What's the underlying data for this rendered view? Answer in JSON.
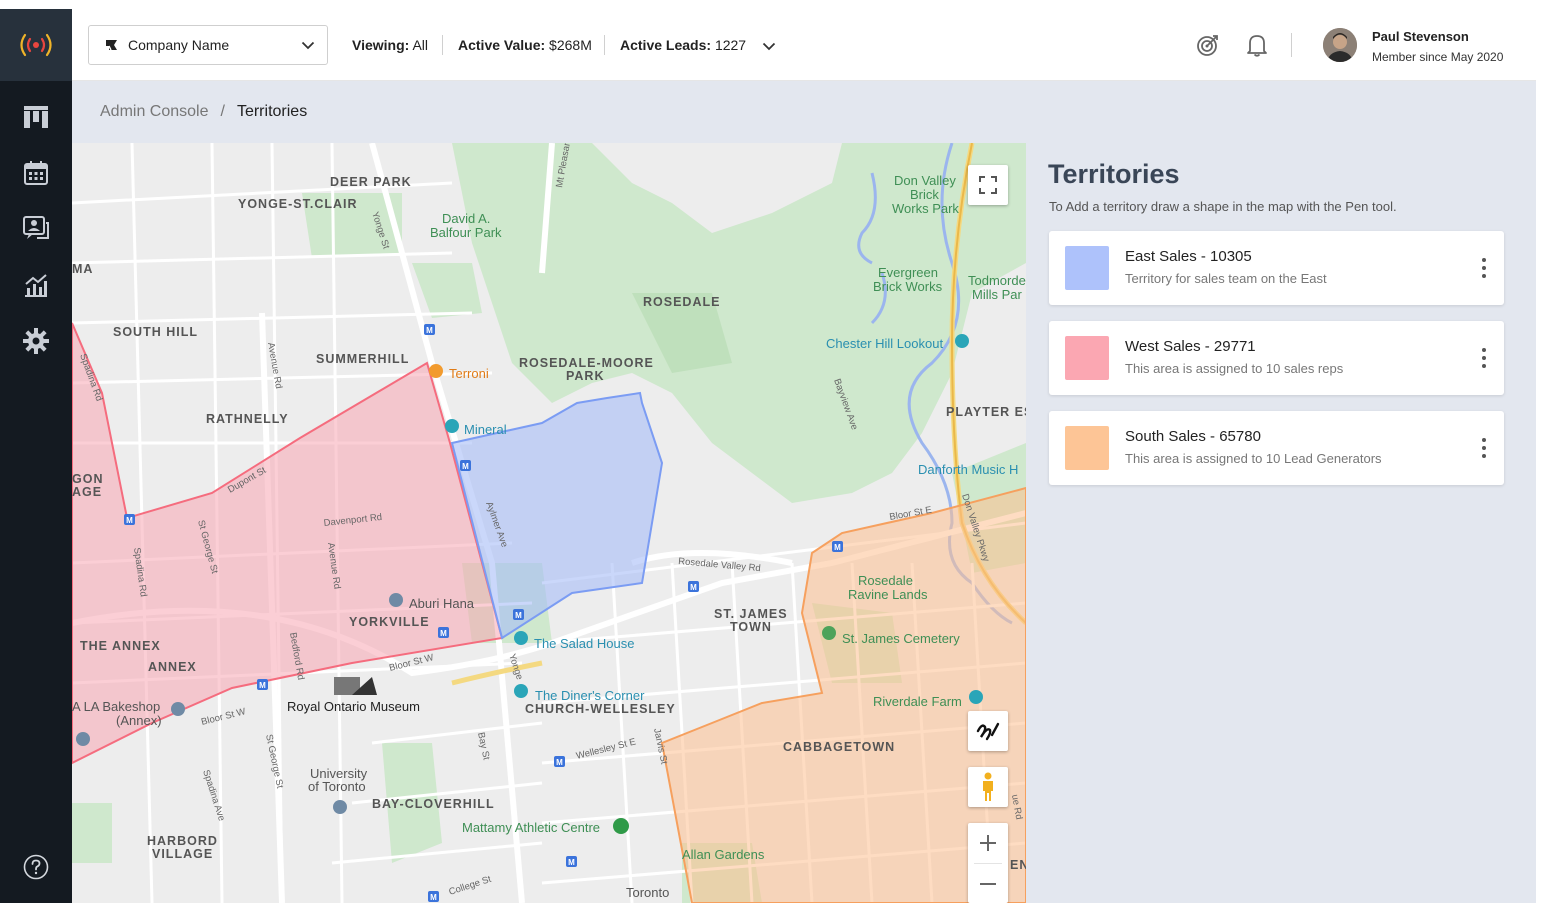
{
  "topbar": {
    "company_name": "Company Name",
    "viewing_label": "Viewing:",
    "viewing_value": "All",
    "active_value_label": "Active Value:",
    "active_value": "$268M",
    "active_leads_label": "Active Leads:",
    "active_leads": "1227"
  },
  "user": {
    "name": "Paul Stevenson",
    "since": "Member since May 2020"
  },
  "sidebar": {
    "items": [
      {
        "icon": "dashboard-icon"
      },
      {
        "icon": "calendar-icon"
      },
      {
        "icon": "contacts-icon"
      },
      {
        "icon": "analytics-icon"
      },
      {
        "icon": "settings-icon"
      }
    ],
    "help_icon": "help-icon"
  },
  "breadcrumb": {
    "root": "Admin Console",
    "separator": "/",
    "current": "Territories"
  },
  "panel": {
    "title": "Territories",
    "subtitle": "To Add a territory draw a shape in the map with the Pen tool."
  },
  "territories": [
    {
      "title": "East Sales - 10305",
      "desc": "Territory for sales team on the East",
      "color": "#aec2fb"
    },
    {
      "title": "West Sales - 29771",
      "desc": "This area is assigned to 10 sales reps",
      "color": "#fba7b2"
    },
    {
      "title": "South Sales - 65780",
      "desc": "This area is assigned to 10 Lead Generators",
      "color": "#fdc596"
    }
  ],
  "map": {
    "labels": {
      "deer_park": "DEER PARK",
      "yonge_st_clair": "YONGE-ST.CLAIR",
      "david_balfour_1": "David A.",
      "david_balfour_2": "Balfour Park",
      "don_valley_1": "Don Valley",
      "don_valley_2": "Brick",
      "don_valley_3": "Works Park",
      "evergreen_1": "Evergreen",
      "evergreen_2": "Brick Works",
      "todmorden_1": "Todmorde",
      "todmorden_2": "Mills Par",
      "rosedale": "ROSEDALE",
      "south_hill": "SOUTH HILL",
      "summerhill": "SUMMERHILL",
      "rosedale_moore_1": "ROSEDALE-MOORE",
      "rosedale_moore_2": "PARK",
      "chester_hill": "Chester Hill Lookout",
      "terroni": "Terroni",
      "rathnelly": "RATHNELLY",
      "mineral": "Mineral",
      "playter": "PLAYTER ES",
      "danforth": "Danforth Music H",
      "gon": "GON",
      "age": "AGE",
      "ma": "MA",
      "rosedale_ravine_1": "Rosedale",
      "rosedale_ravine_2": "Ravine Lands",
      "st_james_town_1": "ST. JAMES",
      "st_james_town_2": "TOWN",
      "aburi_hana": "Aburi Hana",
      "yorkville": "YORKVILLE",
      "salad_house": "The Salad House",
      "st_james_cemetery": "St. James Cemetery",
      "the_annex": "THE ANNEX",
      "annex": "ANNEX",
      "royal_ontario": "Royal Ontario Museum",
      "diners_corner": "The Diner's Corner",
      "church_wellesley": "CHURCH-WELLESLEY",
      "riverdale_farm": "Riverdale Farm",
      "la_bakeshop_1": "A LA Bakeshop",
      "la_bakeshop_2": "(Annex)",
      "cabbagetown": "CABBAGETOWN",
      "uoft_1": "University",
      "uoft_2": "of Toronto",
      "bay_cloverhill": "BAY-CLOVERHILL",
      "mattamy": "Mattamy Athletic Centre",
      "harbord_1": "HARBORD",
      "harbord_2": "VILLAGE",
      "allan_gardens": "Allan Gardens",
      "toronto": "Toronto",
      "en": "EN"
    },
    "streets": {
      "yonge_st": "Yonge St",
      "mt_pleasant": "Mt Pleasan",
      "avenue_rd": "Avenue Rd",
      "avenue_rd_2": "Avenue Rd",
      "dupont": "Dupont St",
      "davenport": "Davenport Rd",
      "st_george": "St George St",
      "spadina": "Spadina Rd",
      "spadina_2": "Spadina Rd",
      "spadina_ave": "Spadina Ave",
      "bedford": "Bedford Rd",
      "aylmer": "Aylmer Ave",
      "rosedale_valley": "Rosedale Valley Rd",
      "bloor_e": "Bloor St E",
      "bloor_w": "Bloor St W",
      "bloor_w_2": "Bloor St W",
      "bayview": "Bayview Ave",
      "don_valley_pkwy": "Don Valley Pkwy",
      "bay_st": "Bay St",
      "yonge_st_2": "Yonge",
      "jarvis": "Jarvis St",
      "wellesley": "Wellesley St E",
      "st_george_2": "St George St",
      "college": "College St",
      "ave_rd_short": "ue Rd"
    }
  }
}
